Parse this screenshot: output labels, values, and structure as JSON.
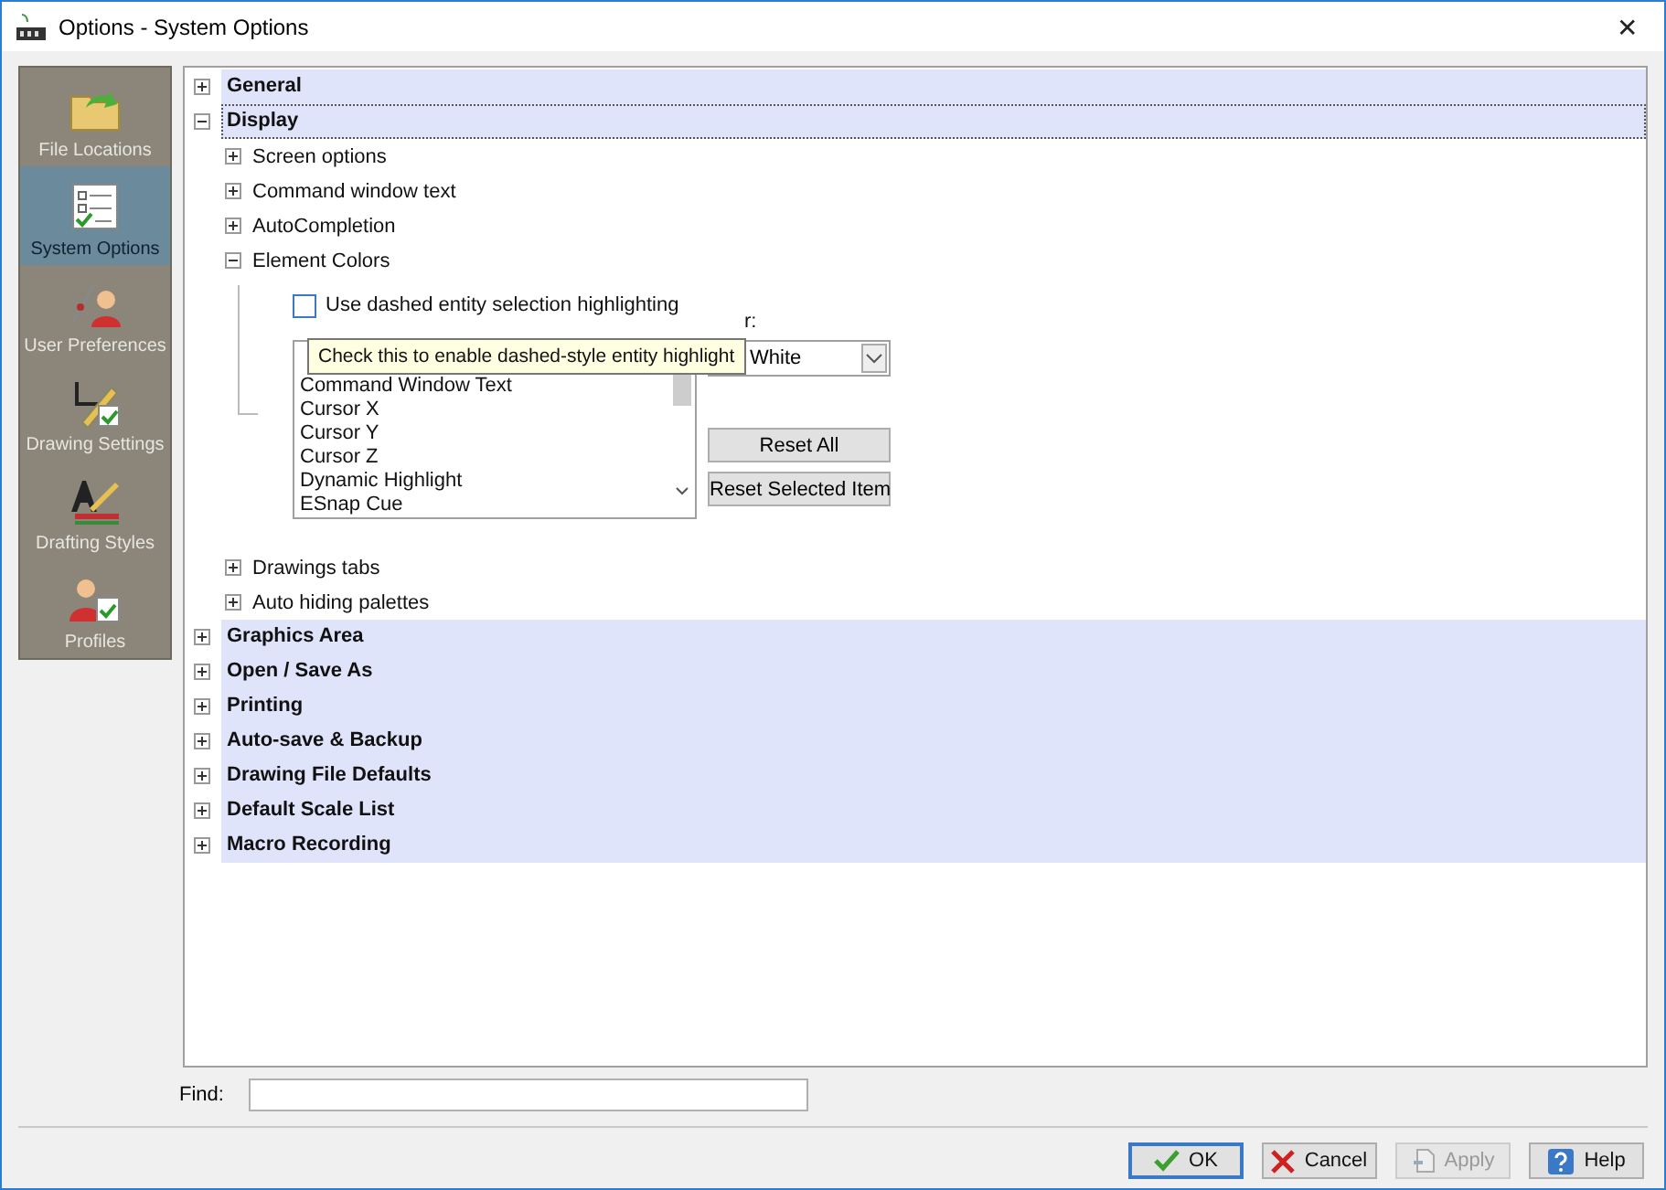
{
  "window": {
    "title": "Options - System Options",
    "close": "✕"
  },
  "sidebar": {
    "items": [
      {
        "label": "File Locations",
        "selected": false
      },
      {
        "label": "System Options",
        "selected": true
      },
      {
        "label": "User Preferences",
        "selected": false
      },
      {
        "label": "Drawing Settings",
        "selected": false
      },
      {
        "label": "Drafting Styles",
        "selected": false
      },
      {
        "label": "Profiles",
        "selected": false
      }
    ]
  },
  "tree": [
    {
      "label": "General",
      "expanded": false,
      "selected": false
    },
    {
      "label": "Display",
      "expanded": true,
      "selected": true,
      "children": [
        {
          "label": "Screen options",
          "expanded": false
        },
        {
          "label": "Command window text",
          "expanded": false
        },
        {
          "label": "AutoCompletion",
          "expanded": false
        },
        {
          "label": "Element Colors",
          "expanded": true,
          "panel": {
            "checkbox": {
              "label": "Use dashed entity selection highlighting",
              "checked": false
            },
            "tooltip": "Check this to enable dashed-style entity highlight",
            "list": [
              "Command Window Text",
              "Cursor X",
              "Cursor Y",
              "Cursor Z",
              "Dynamic Highlight",
              "ESnap Cue"
            ],
            "color_label": "r:",
            "color_value": "White",
            "buttons": [
              "Reset All",
              "Reset Selected Item"
            ]
          }
        },
        {
          "label": "Drawings tabs",
          "expanded": false
        },
        {
          "label": "Auto hiding palettes",
          "expanded": false
        }
      ]
    },
    {
      "label": "Graphics Area",
      "expanded": false,
      "selected": false
    },
    {
      "label": "Open / Save As",
      "expanded": false,
      "selected": false
    },
    {
      "label": "Printing",
      "expanded": false,
      "selected": false
    },
    {
      "label": "Auto-save & Backup",
      "expanded": false,
      "selected": false
    },
    {
      "label": "Drawing File Defaults",
      "expanded": false,
      "selected": false
    },
    {
      "label": "Default Scale List",
      "expanded": false,
      "selected": false
    },
    {
      "label": "Macro Recording",
      "expanded": false,
      "selected": false
    }
  ],
  "find": {
    "label": "Find:"
  },
  "buttons": [
    {
      "label": "OK",
      "kind": "ok",
      "disabled": false
    },
    {
      "label": "Cancel",
      "kind": "cancel",
      "disabled": false
    },
    {
      "label": "Apply",
      "kind": "apply",
      "disabled": true
    },
    {
      "label": "Help",
      "kind": "help",
      "disabled": false
    }
  ]
}
